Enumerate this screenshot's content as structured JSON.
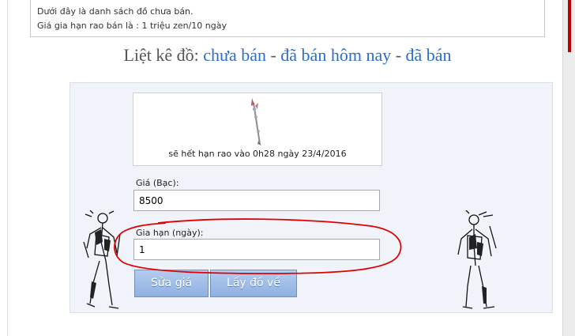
{
  "notice": {
    "line1": "Dưới đây là danh sách đồ chưa bán.",
    "line2": "Giá gia hạn rao bán là : 1 triệu zen/10 ngày"
  },
  "heading": {
    "prefix": "Liệt kê đồ:",
    "links": [
      "chưa bán",
      "đã bán hôm nay",
      "đã bán"
    ],
    "separator": "-"
  },
  "item": {
    "icon": "spear-item-icon",
    "expire_text": "sẽ hết hạn rao vào 0h28 ngày 23/4/2016"
  },
  "form": {
    "price_label": "Giá (Bạc):",
    "price_value": "8500",
    "duration_label": "Gia hạn (ngày):",
    "duration_value": "1"
  },
  "buttons": {
    "edit_price": "Sửa giá",
    "retrieve": "Lấy đồ về"
  },
  "colors": {
    "link": "#2a6fc9",
    "button": "#9ab8e6",
    "annotation": "#e00000"
  }
}
